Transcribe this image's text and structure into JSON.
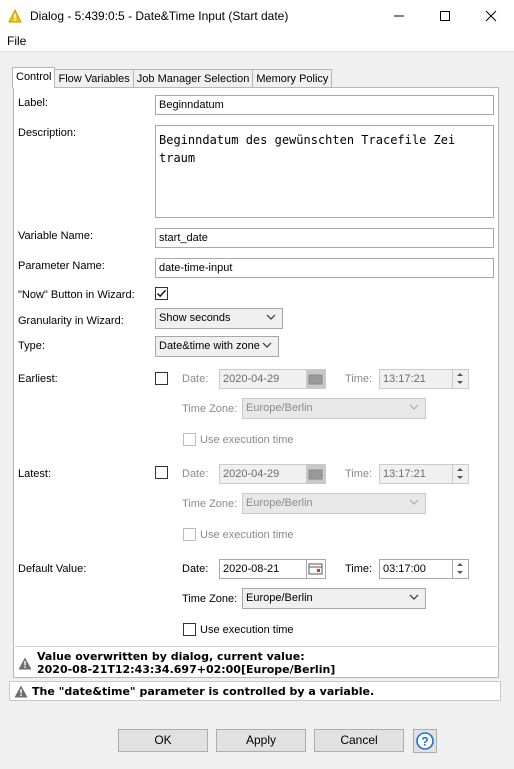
{
  "window": {
    "title": "Dialog - 5:439:0:5 - Date&Time Input (Start date)",
    "minimize_icon": "minimize-icon",
    "maximize_icon": "maximize-icon",
    "close_icon": "close-icon"
  },
  "menu": {
    "file": "File"
  },
  "tabs": [
    {
      "label": "Control",
      "active": true
    },
    {
      "label": "Flow Variables",
      "active": false
    },
    {
      "label": "Job Manager Selection",
      "active": false
    },
    {
      "label": "Memory Policy",
      "active": false
    }
  ],
  "form": {
    "label_label": "Label:",
    "label_value": "Beginndatum",
    "description_label": "Description:",
    "description_value": "Beginndatum des gewünschten Tracefile Zei\ntraum",
    "variable_name_label": "Variable Name:",
    "variable_name_value": "start_date",
    "parameter_name_label": "Parameter Name:",
    "parameter_name_value": "date-time-input",
    "now_button_label": "\"Now\" Button in Wizard:",
    "now_button_checked": true,
    "granularity_label": "Granularity in Wizard:",
    "granularity_value": "Show seconds",
    "type_label": "Type:",
    "type_value": "Date&time with zone",
    "earliest": {
      "label": "Earliest:",
      "enabled": false,
      "date_label": "Date:",
      "date_value": "2020-04-29",
      "time_label": "Time:",
      "time_value": "13:17:21",
      "zone_label": "Time Zone:",
      "zone_value": "Europe/Berlin",
      "exec_label": "Use execution time"
    },
    "latest": {
      "label": "Latest:",
      "enabled": false,
      "date_label": "Date:",
      "date_value": "2020-04-29",
      "time_label": "Time:",
      "time_value": "13:17:21",
      "zone_label": "Time Zone:",
      "zone_value": "Europe/Berlin",
      "exec_label": "Use execution time"
    },
    "default": {
      "label": "Default Value:",
      "date_label": "Date:",
      "date_value": "2020-08-21",
      "time_label": "Time:",
      "time_value": "03:17:00",
      "zone_label": "Time Zone:",
      "zone_value": "Europe/Berlin",
      "exec_label": "Use execution time"
    }
  },
  "messages": {
    "overwritten_line1": "Value overwritten by dialog, current value:",
    "overwritten_line2": "2020-08-21T12:43:34.697+02:00[Europe/Berlin]",
    "controlled": "The \"date&time\" parameter is controlled by a variable."
  },
  "buttons": {
    "ok": "OK",
    "apply": "Apply",
    "cancel": "Cancel",
    "help_icon": "help-icon"
  },
  "colors": {
    "warning_yellow": "#f5c400",
    "help_blue": "#1a6fd1"
  }
}
